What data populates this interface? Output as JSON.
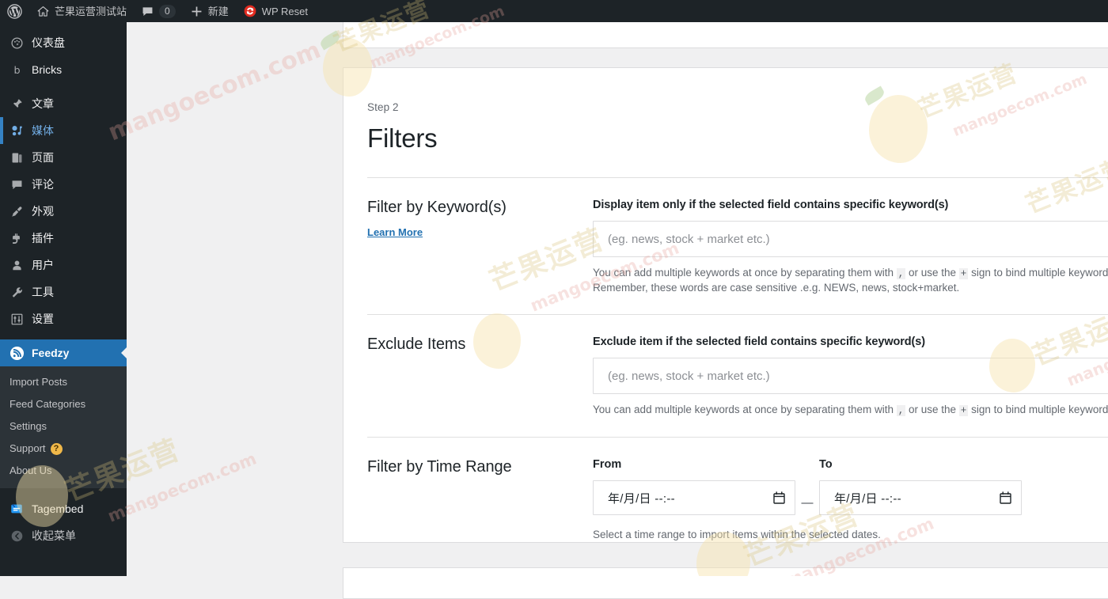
{
  "adminbar": {
    "wp_logo_icon": "wordpress-logo-icon",
    "site_icon": "home-icon",
    "site_name": "芒果运营测试站",
    "comments_icon": "comment-bubble-icon",
    "comments_count": "0",
    "new_icon": "plus-icon",
    "new_label": "新建",
    "wpreset_icon": "wp-reset-icon",
    "wpreset_label": "WP Reset"
  },
  "sidebar": {
    "items": [
      {
        "label": "仪表盘",
        "icon": "dashboard-icon",
        "state": "default"
      },
      {
        "label": "Bricks",
        "icon": "bricks-b-icon",
        "state": "default"
      },
      {
        "label": "文章",
        "icon": "pin-icon",
        "state": "default"
      },
      {
        "label": "媒体",
        "icon": "media-icon",
        "state": "hover"
      },
      {
        "label": "页面",
        "icon": "page-icon",
        "state": "default"
      },
      {
        "label": "评论",
        "icon": "comment-icon",
        "state": "default"
      },
      {
        "label": "外观",
        "icon": "appearance-icon",
        "state": "default"
      },
      {
        "label": "插件",
        "icon": "plugin-icon",
        "state": "default"
      },
      {
        "label": "用户",
        "icon": "users-icon",
        "state": "default"
      },
      {
        "label": "工具",
        "icon": "tools-icon",
        "state": "default"
      },
      {
        "label": "设置",
        "icon": "settings-icon",
        "state": "default"
      }
    ],
    "active_item": {
      "label": "Feedzy",
      "icon": "feedzy-rss-icon"
    },
    "submenu": [
      {
        "label": "Import Posts",
        "badge": ""
      },
      {
        "label": "Feed Categories",
        "badge": ""
      },
      {
        "label": "Settings",
        "badge": ""
      },
      {
        "label": "Support",
        "badge": "?"
      },
      {
        "label": "About Us",
        "badge": ""
      }
    ],
    "after_items": [
      {
        "label": "Tagembed",
        "icon": "tagembed-icon"
      }
    ],
    "collapse": {
      "label": "收起菜单",
      "icon": "collapse-arrow-icon"
    },
    "active_color": "#2271b1",
    "hover_color": "#72aee6",
    "background": "#1d2327",
    "submenu_background": "#2c3338"
  },
  "main": {
    "step_label": "Step 2",
    "title": "Filters",
    "sections": [
      {
        "key": "keywords",
        "title": "Filter by Keyword(s)",
        "learn_more": "Learn More",
        "field_label": "Display item only if the selected field contains specific keyword(s)",
        "input_value": "",
        "input_placeholder": "(eg. news, stock + market etc.)",
        "help_line1_a": "You can add multiple keywords at once by separating them with ",
        "help_comma": ",",
        "help_line1_b": " or use the ",
        "help_plus": "+",
        "help_line1_c": " sign to bind multiple keywords.",
        "help_line2": "Remember, these words are case sensitive .e.g. NEWS, news, stock+market."
      },
      {
        "key": "exclude",
        "title": "Exclude Items",
        "field_label": "Exclude item if the selected field contains specific keyword(s)",
        "input_value": "",
        "input_placeholder": "(eg. news, stock + market etc.)",
        "help_line1_a": "You can add multiple keywords at once by separating them with ",
        "help_comma": ",",
        "help_line1_b": " or use the ",
        "help_plus": "+",
        "help_line1_c": " sign to bind multiple keywords."
      }
    ],
    "time_range": {
      "title": "Filter by Time Range",
      "from_label": "From",
      "to_label": "To",
      "separator": "—",
      "from_value": "年/月/日 --:--",
      "to_value": "年/月/日 --:--",
      "calendar_icon": "calendar-icon",
      "help": "Select a time range to import items within the selected dates."
    }
  },
  "watermark": {
    "cn": "芒果运营",
    "en": "mangoecom.com"
  }
}
